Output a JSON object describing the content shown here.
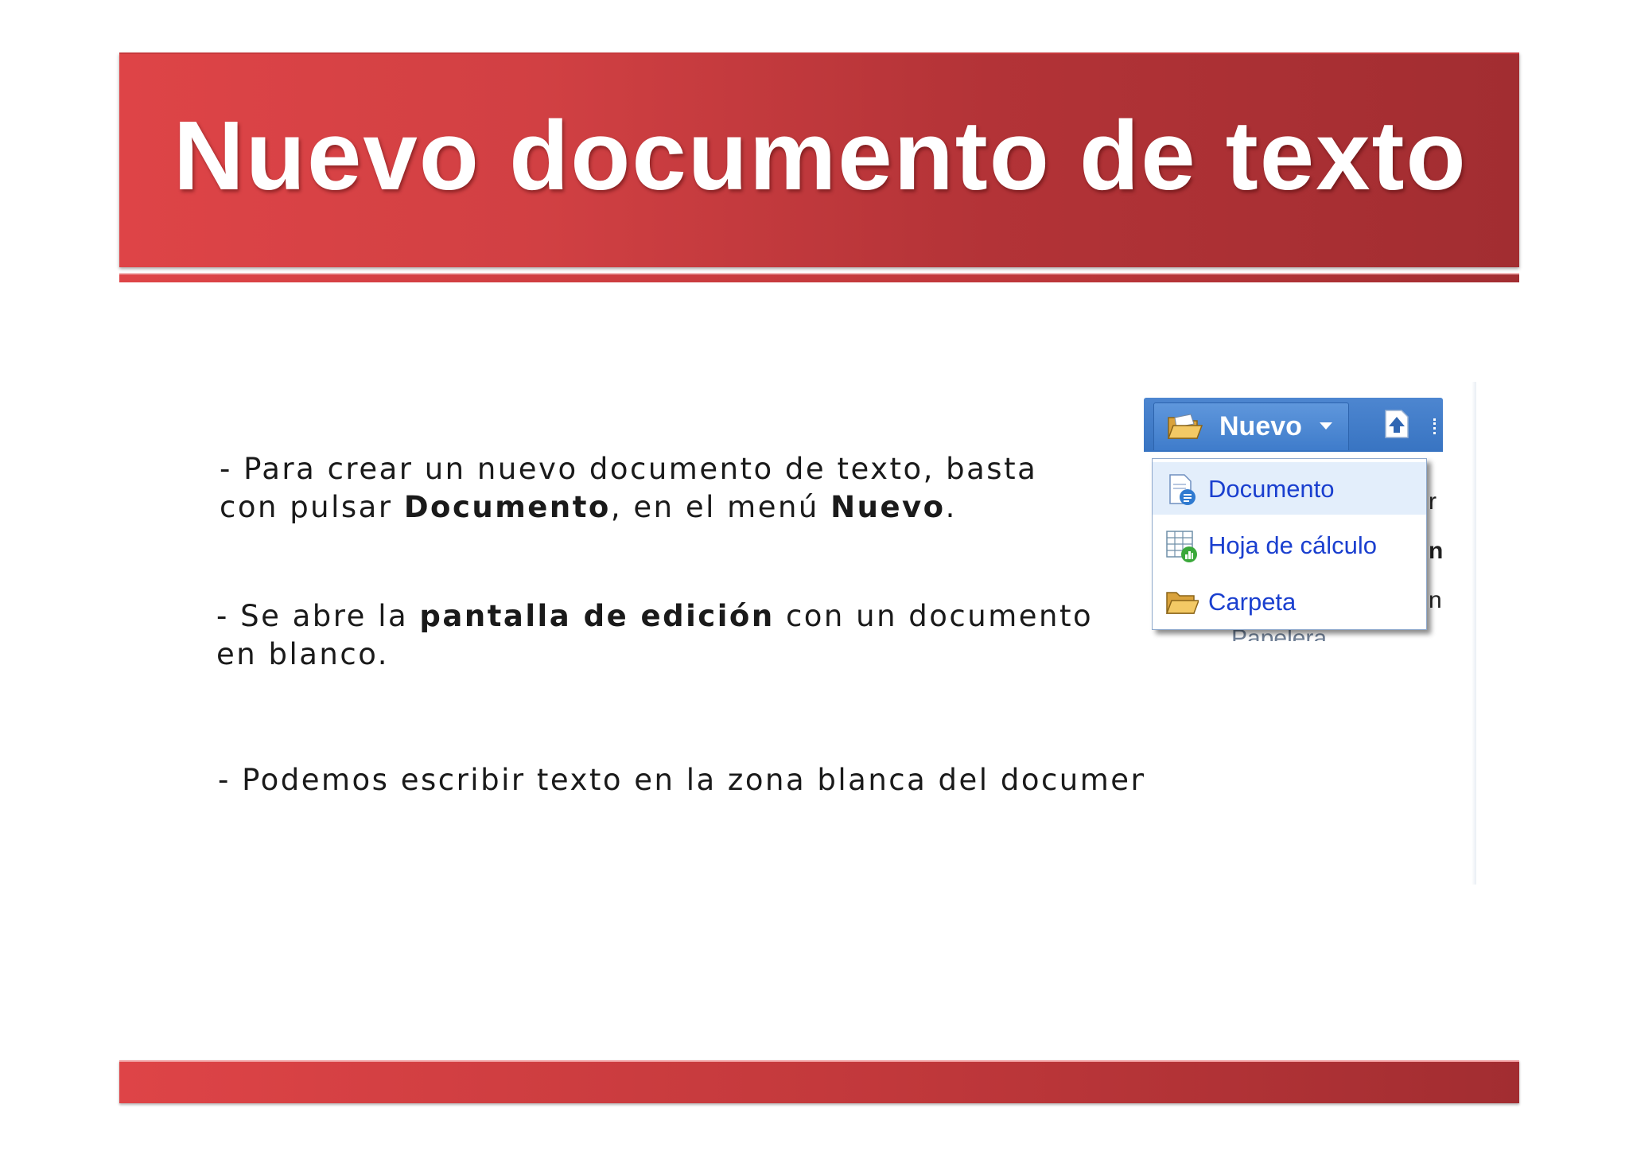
{
  "slide": {
    "title": "Nuevo documento de texto",
    "bullets": [
      {
        "line1_a": "- Para crear un nuevo documento de texto, basta",
        "line2_a": "con pulsar ",
        "line2_b": "Documento",
        "line2_c": ", en el menú ",
        "line2_d": "Nuevo",
        "line2_e": "."
      },
      {
        "line1_a": "- Se abre la ",
        "line1_b": "pantalla de edición",
        "line1_c": " con un documento",
        "line2_a": "en blanco."
      },
      {
        "line1_a": "- Podemos escribir texto en la zona blanca del documento."
      }
    ]
  },
  "screenshot": {
    "nuevo_button_label": "Nuevo",
    "menu_items": [
      {
        "label": "Documento",
        "icon": "document-icon",
        "highlighted": true
      },
      {
        "label": "Hoja de cálculo",
        "icon": "spreadsheet-icon",
        "highlighted": false
      },
      {
        "label": "Carpeta",
        "icon": "folder-icon",
        "highlighted": false
      }
    ],
    "behind_item": "Papelera",
    "edge_chars": [
      "r",
      "n",
      "n"
    ],
    "colors": {
      "toolbar_blue": "#3874c2",
      "menu_link": "#1a3fcf",
      "menu_highlight": "#e3eefb",
      "banner_red": "#c1383b"
    }
  }
}
